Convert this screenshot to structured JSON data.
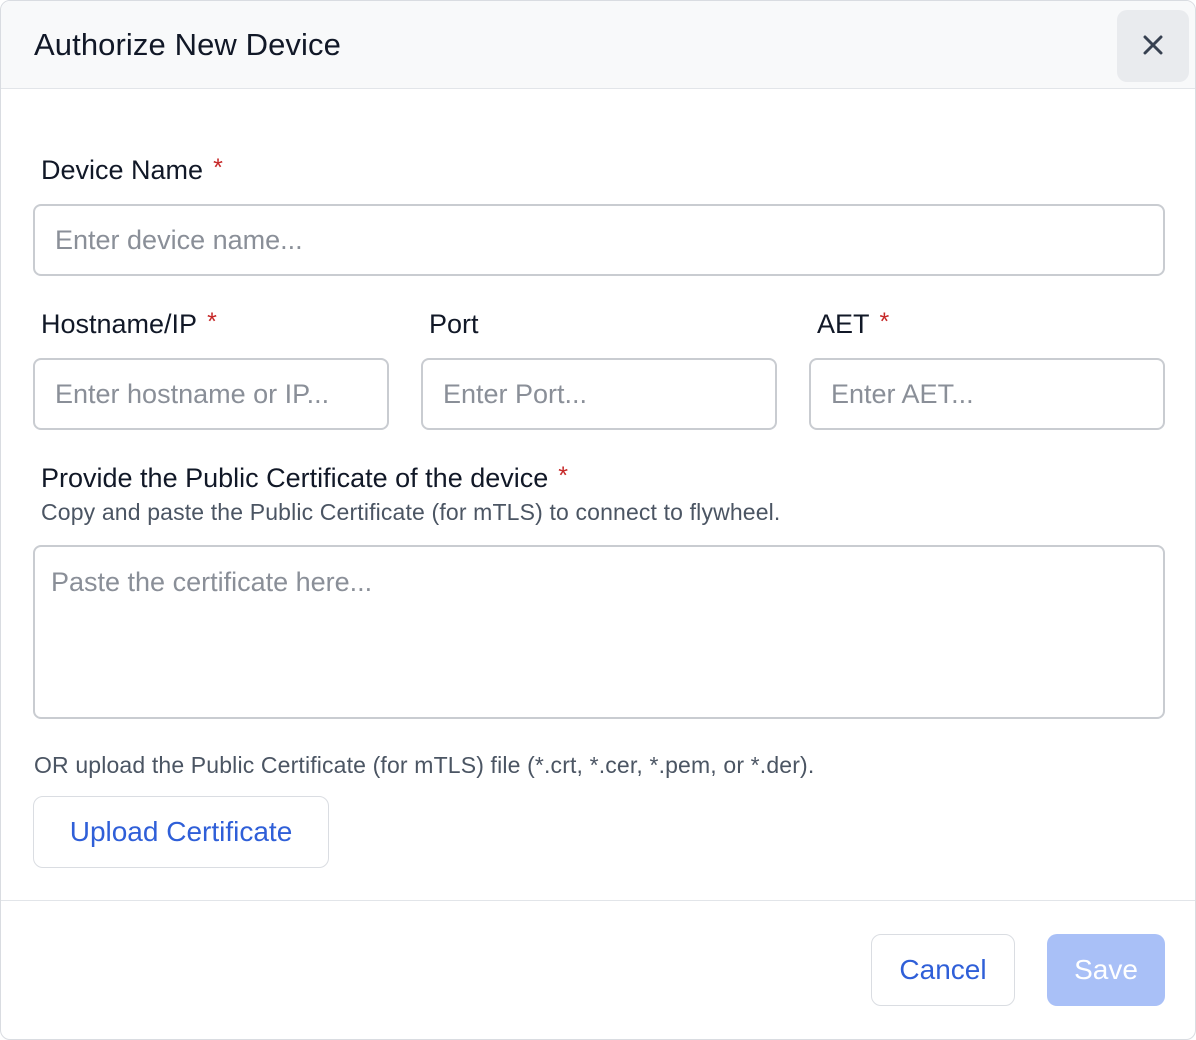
{
  "dialog": {
    "title": "Authorize New Device",
    "close_icon": "close-icon"
  },
  "form": {
    "device_name": {
      "label": "Device Name",
      "required_mark": "*",
      "value": "",
      "placeholder": "Enter device name..."
    },
    "hostname": {
      "label": "Hostname/IP",
      "required_mark": "*",
      "value": "",
      "placeholder": "Enter hostname or IP..."
    },
    "port": {
      "label": "Port",
      "value": "",
      "placeholder": "Enter Port..."
    },
    "aet": {
      "label": "AET",
      "required_mark": "*",
      "value": "",
      "placeholder": "Enter AET..."
    },
    "certificate": {
      "label": "Provide the Public Certificate of the device",
      "required_mark": "*",
      "helper": "Copy and paste the Public Certificate (for mTLS) to connect to flywheel.",
      "value": "",
      "placeholder": "Paste the certificate here..."
    },
    "upload": {
      "helper": "OR upload the Public Certificate (for mTLS) file (*.crt, *.cer, *.pem, or *.der).",
      "button_label": "Upload Certificate"
    }
  },
  "footer": {
    "cancel_label": "Cancel",
    "save_label": "Save",
    "save_disabled": true
  },
  "colors": {
    "accent": "#2f5fd8",
    "required": "#c62828",
    "save_disabled_bg": "#a9c0f7"
  }
}
